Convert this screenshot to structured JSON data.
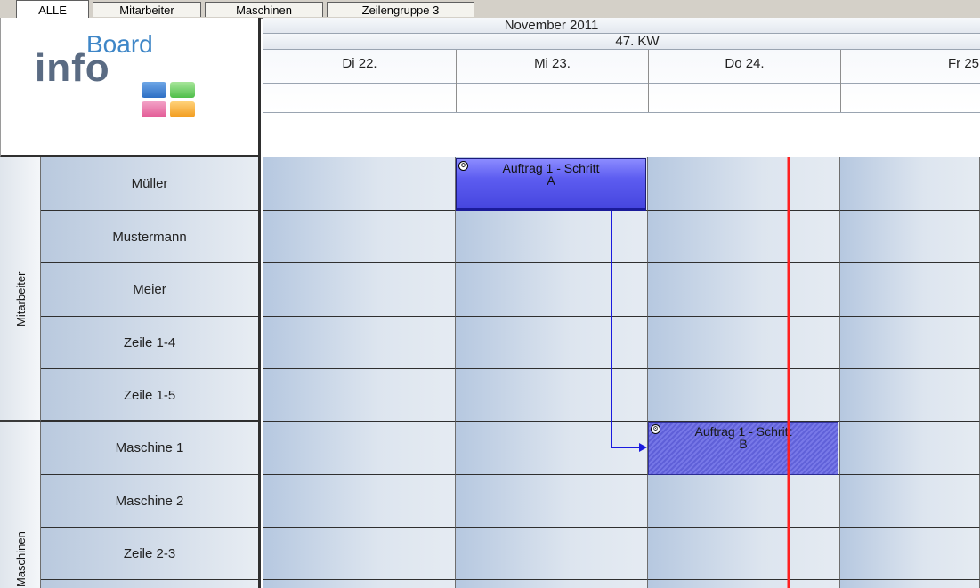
{
  "tabs": [
    {
      "label": "ALLE",
      "active": true
    },
    {
      "label": "Mitarbeiter",
      "active": false
    },
    {
      "label": "Maschinen",
      "active": false
    },
    {
      "label": "Zeilengruppe 3",
      "active": false
    }
  ],
  "logo": {
    "text_info": "info",
    "text_board": "Board"
  },
  "header": {
    "month": "November 2011",
    "week": "47. KW",
    "days": [
      "Di 22.",
      "Mi 23.",
      "Do 24.",
      "Fr 25."
    ]
  },
  "groups": [
    {
      "label": "Mitarbeiter",
      "rows": [
        "Müller",
        "Mustermann",
        "Meier",
        "Zeile 1-4",
        "Zeile 1-5"
      ]
    },
    {
      "label": "Maschinen",
      "rows": [
        "Maschine 1",
        "Maschine 2",
        "Zeile 2-3"
      ]
    }
  ],
  "tasks": [
    {
      "id": "A",
      "line1": "Auftrag 1 - Schritt",
      "line2": "A",
      "icon": "gear-icon"
    },
    {
      "id": "B",
      "line1": "Auftrag 1 - Schritt",
      "line2": "B",
      "icon": "gear-icon"
    }
  ],
  "colors": {
    "today_line": "#ff2020",
    "connector": "#1a1adf",
    "task_fill": "#5c5cf0"
  }
}
